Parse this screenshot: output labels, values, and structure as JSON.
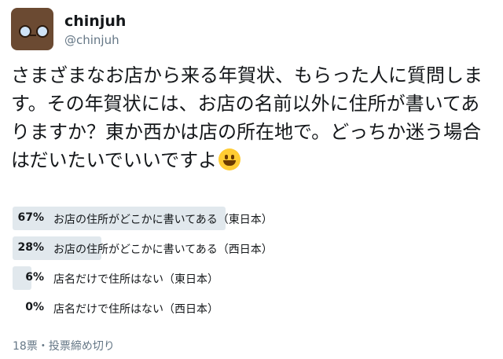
{
  "user": {
    "display_name": "chinjuh",
    "handle": "@chinjuh"
  },
  "tweet": {
    "text": "さまざまなお店から来る年賀状、もらった人に質問します。その年賀状には、お店の名前以外に住所が書いてありますか？東か西かは店の所在地で。どっちか迷う場合はだいたいでいいですよ",
    "emoji": "grinning-face"
  },
  "poll": {
    "options": [
      {
        "percent": "67%",
        "label": "お店の住所がどこかに書いてある（東日本）",
        "value": 67
      },
      {
        "percent": "28%",
        "label": "お店の住所がどこかに書いてある（西日本）",
        "value": 28
      },
      {
        "percent": "6%",
        "label": "店名だけで住所はない（東日本）",
        "value": 6
      },
      {
        "percent": "0%",
        "label": "店名だけで住所はない（西日本）",
        "value": 0
      }
    ],
    "footer": "18票・投票締め切り"
  },
  "colors": {
    "bar": "#e1e8ed",
    "secondary_text": "#657786"
  }
}
